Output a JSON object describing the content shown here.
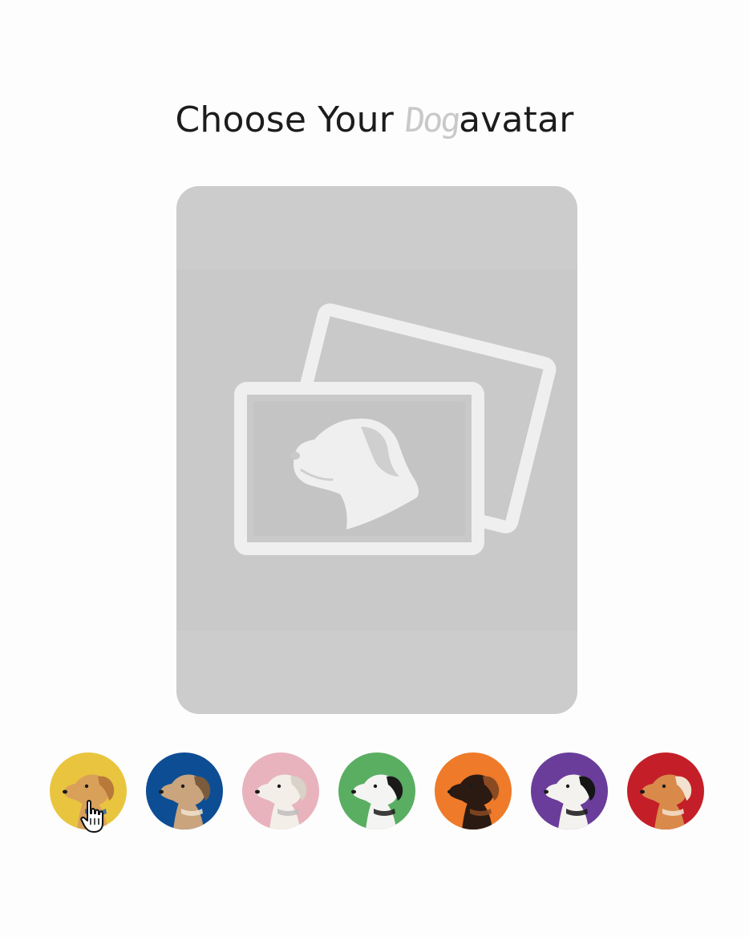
{
  "title": {
    "prefix": "Choose Your ",
    "accent": "Dog",
    "suffix": "avatar"
  },
  "preview": {
    "icon": "dog-photo-placeholder-icon",
    "background": "#cccccc"
  },
  "avatars": [
    {
      "breed_icon": "golden-retriever-avatar",
      "bg": "#e9c53f",
      "dog": "#d9a05a",
      "dark": "#b8793a",
      "accent": "#2e5fa8"
    },
    {
      "breed_icon": "whippet-avatar",
      "bg": "#0d4d94",
      "dog": "#c9a47c",
      "dark": "#7a5b3c",
      "accent": "#f1e3cf"
    },
    {
      "breed_icon": "poodle-avatar",
      "bg": "#e8b3bd",
      "dog": "#f3efe8",
      "dark": "#d8d2c8",
      "accent": "#bdbdbd"
    },
    {
      "breed_icon": "dalmatian-avatar",
      "bg": "#5aae62",
      "dog": "#f4f4f2",
      "dark": "#1a1a1a",
      "accent": "#1a1a1a"
    },
    {
      "breed_icon": "dachshund-avatar",
      "bg": "#ee7a2a",
      "dog": "#2a1a12",
      "dark": "#8a4a22",
      "accent": "#8a4a22"
    },
    {
      "breed_icon": "border-collie-avatar",
      "bg": "#6a3d9a",
      "dog": "#f4f2ee",
      "dark": "#151515",
      "accent": "#151515"
    },
    {
      "breed_icon": "shiba-inu-avatar",
      "bg": "#c41f28",
      "dog": "#d98a4a",
      "dark": "#f2e2cf",
      "accent": "#f2e2cf"
    }
  ],
  "cursor_icon": "hand-pointer-icon"
}
